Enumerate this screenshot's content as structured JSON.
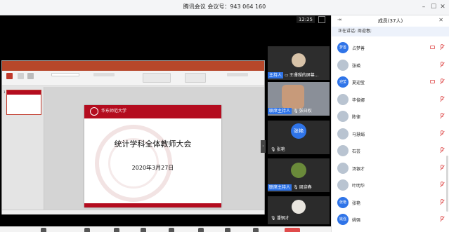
{
  "window": {
    "title": "腾讯会议 会议号：943 064 160"
  },
  "stage": {
    "clock": "12:25",
    "ppt": {
      "slide_number": "1",
      "university": "华东师范大学",
      "slide_title": "统计学科全体教师大会",
      "slide_date": "2020年3月27日"
    }
  },
  "videos": [
    {
      "tag": "主持人",
      "name": "王珊瑚的屏幕..."
    },
    {
      "tag": "联席主持人",
      "name": "张日权"
    },
    {
      "avatar_text": "张艳",
      "name": "张艳"
    },
    {
      "tag": "联席主持人",
      "name": "周迎春"
    },
    {
      "name": "潘钢才"
    }
  ],
  "panel": {
    "title": "成员(37人)",
    "speaking_label": "正在讲话: 周迎春;",
    "members": [
      {
        "avatar_text": "梦善",
        "name": "占梦善",
        "camera": true
      },
      {
        "avatar_text": "",
        "name": "张瑛",
        "camera": false
      },
      {
        "avatar_text": "迎莹",
        "name": "夏迎莹",
        "camera": true
      },
      {
        "avatar_text": "",
        "name": "毕俊娜",
        "camera": false
      },
      {
        "avatar_text": "",
        "name": "陈律",
        "camera": false
      },
      {
        "avatar_text": "",
        "name": "马慧娟",
        "camera": false
      },
      {
        "avatar_text": "",
        "name": "石芸",
        "camera": false
      },
      {
        "avatar_text": "",
        "name": "汤银才",
        "camera": false
      },
      {
        "avatar_text": "",
        "name": "叶明华",
        "camera": false
      },
      {
        "avatar_text": "张艳",
        "name": "张艳",
        "camera": false
      },
      {
        "avatar_text": "姚强",
        "name": "姚强",
        "camera": false
      }
    ]
  },
  "colors": {
    "accent_blue": "#2f74e8",
    "brand_red": "#b40c1f",
    "mute_red": "#e46a6a"
  }
}
